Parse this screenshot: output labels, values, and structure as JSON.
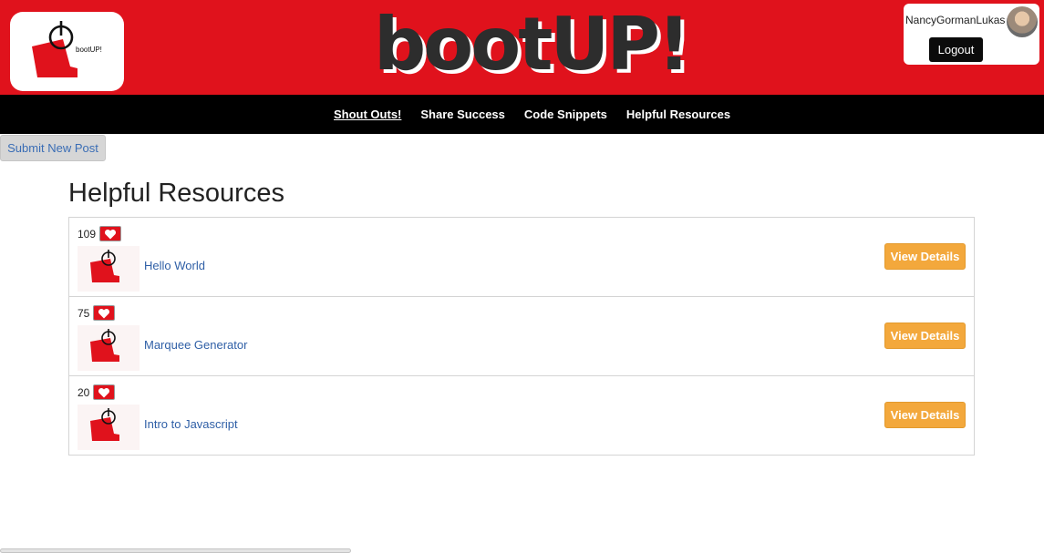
{
  "header": {
    "brand": "bootUP!",
    "logo_text": "bootUP!",
    "user": {
      "name": "NancyGormanLukas",
      "logout_label": "Logout"
    }
  },
  "nav": {
    "items": [
      {
        "label": "Shout Outs!",
        "active": true
      },
      {
        "label": "Share Success",
        "active": false
      },
      {
        "label": "Code Snippets",
        "active": false
      },
      {
        "label": "Helpful Resources",
        "active": false
      }
    ]
  },
  "actions": {
    "submit_label": "Submit New Post"
  },
  "page": {
    "title": "Helpful Resources"
  },
  "resources": [
    {
      "likes": "109",
      "title": "Hello World",
      "details_label": "View Details"
    },
    {
      "likes": "75",
      "title": "Marquee Generator",
      "details_label": "View Details"
    },
    {
      "likes": "20",
      "title": "Intro to Javascript",
      "details_label": "View Details"
    }
  ],
  "colors": {
    "brand_red": "#e0121c",
    "nav_black": "#000000",
    "details_orange": "#f3a83c",
    "link_blue": "#2f5fa6"
  },
  "icons": {
    "logo": "power-boot-logo-icon",
    "like": "heart-icon",
    "avatar": "user-avatar"
  }
}
